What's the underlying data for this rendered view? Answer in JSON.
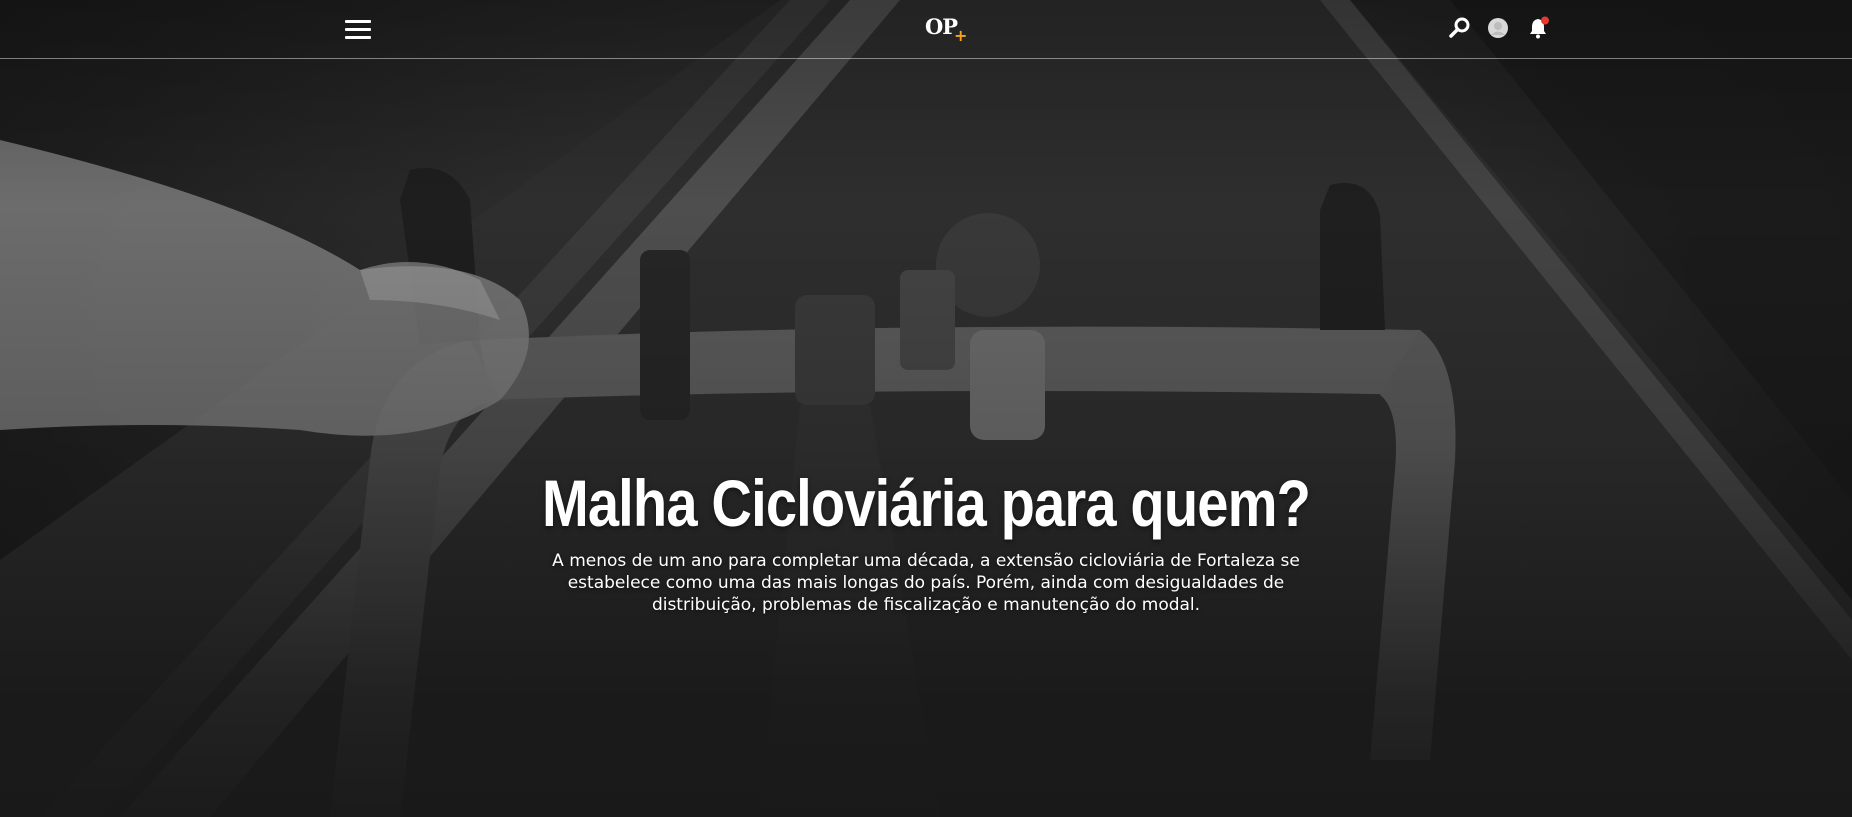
{
  "header": {
    "logo_text": "OP",
    "logo_plus": "+",
    "menu_icon": "hamburger-menu-icon",
    "search_icon": "search-icon",
    "user_icon": "user-avatar-icon",
    "notification_icon": "bell-icon",
    "notification_badge_color": "#e53935",
    "brand_accent": "#f2a51a"
  },
  "hero": {
    "title": "Malha Cicloviária para quem?",
    "subtitle": "A menos de um ano para completar uma década, a extensão cicloviária de Fortaleza se estabelece como uma das mais longas do país. Porém, ainda com desigualdades de distribuição, problemas de fiscalização e manutenção do modal.",
    "background_image": "black-and-white-bicycle-handlebar-photo"
  }
}
